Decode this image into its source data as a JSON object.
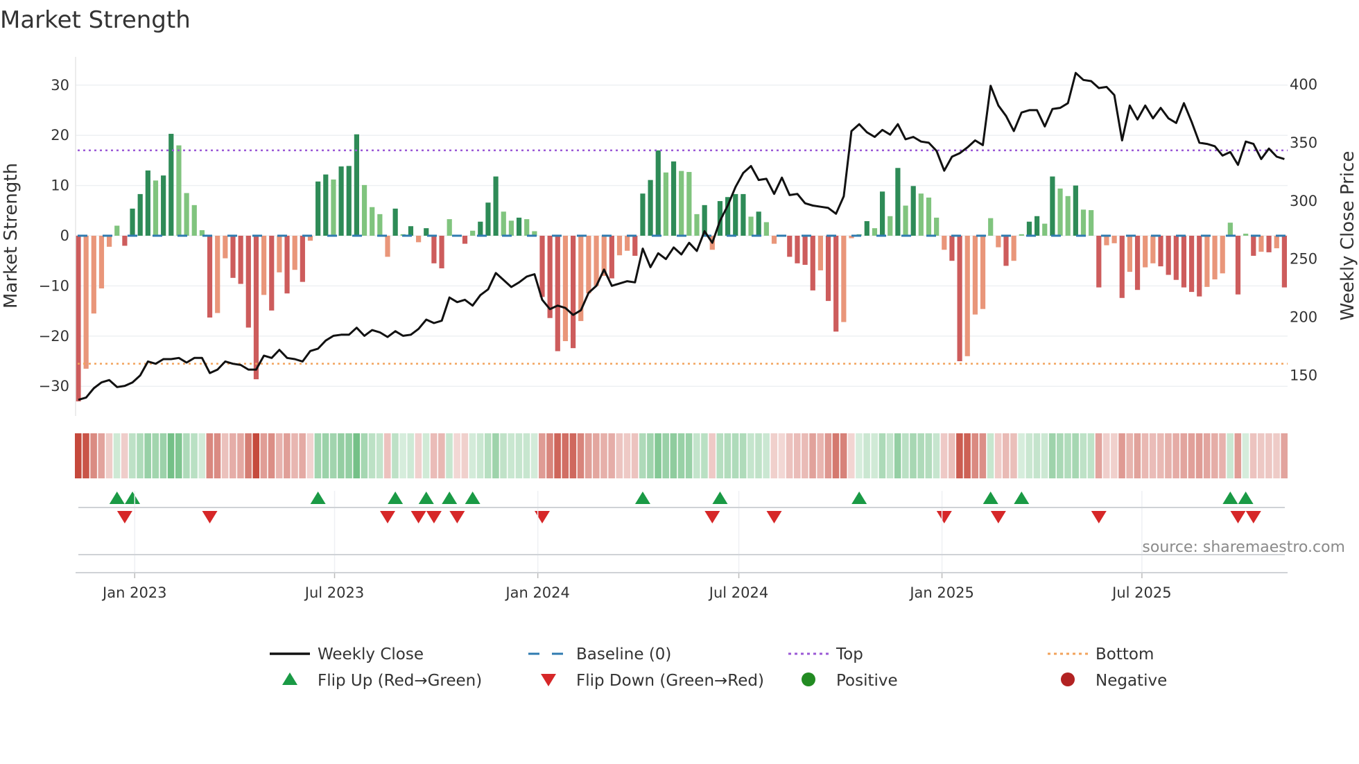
{
  "chart_data": {
    "type": "bar",
    "title": "Market Strength",
    "ylabel": "Market Strength",
    "y2label": "Weekly Close Price",
    "ylim": [
      -35,
      35
    ],
    "y2lim": [
      120,
      410
    ],
    "yticks": [
      30,
      20,
      10,
      0,
      -10,
      -20,
      -30
    ],
    "y2ticks": [
      400,
      350,
      300,
      250,
      200,
      150
    ],
    "ytick_labels": [
      "30",
      "20",
      "10",
      "0",
      "−10",
      "−20",
      "−30"
    ],
    "y2tick_labels": [
      "400",
      "350",
      "300",
      "250",
      "200",
      "150"
    ],
    "top_level": 17,
    "bottom_level": -25.5,
    "baseline": 0,
    "xticks": [
      {
        "label": "Jan 2023",
        "week": 7.29
      },
      {
        "label": "Jul 2023",
        "week": 33.14
      },
      {
        "label": "Jan 2024",
        "week": 59.43
      },
      {
        "label": "Jul 2024",
        "week": 85.43
      },
      {
        "label": "Jan 2025",
        "week": 111.71
      },
      {
        "label": "Jul 2025",
        "week": 137.57
      }
    ],
    "strength": [
      -33,
      -26.5,
      -15.5,
      -10.5,
      -2.2,
      2,
      -2,
      5.4,
      8.3,
      13,
      11,
      12,
      20.3,
      18,
      8.5,
      6.1,
      1.1,
      -16.3,
      -15.4,
      -4.5,
      -8.4,
      -9.6,
      -18.3,
      -28.6,
      -11.8,
      -14.9,
      -7.3,
      -11.5,
      -6.8,
      -9.2,
      -1,
      10.8,
      12.2,
      11.2,
      13.8,
      13.9,
      20.2,
      10.1,
      5.7,
      4.3,
      -4.2,
      5.4,
      0.3,
      1.9,
      -1.3,
      1.5,
      -5.5,
      -6.5,
      3.3,
      -0.2,
      -1.6,
      1,
      2.8,
      6.6,
      11.8,
      4.8,
      3,
      3.6,
      3.3,
      0.9,
      -12.2,
      -16.4,
      -23,
      -21,
      -22.4,
      -17,
      -11.5,
      -10,
      -8,
      -8.5,
      -3.9,
      -3,
      -4,
      8.4,
      11.1,
      17,
      12.6,
      14.8,
      12.9,
      12.7,
      4.3,
      6.1,
      -2.8,
      6.9,
      7.7,
      8.3,
      8.3,
      3.8,
      4.8,
      2.7,
      -1.6,
      -0.2,
      -4.2,
      -5.5,
      -5.8,
      -10.9,
      -6.9,
      -13,
      -19.1,
      -17.2,
      -0.5,
      0.3,
      2.9,
      1.5,
      8.8,
      3.9,
      13.5,
      6,
      9.9,
      8.4,
      7.6,
      3.6,
      -2.8,
      -5,
      -25,
      -24,
      -15.7,
      -14.6,
      3.5,
      -2.3,
      -6,
      -5,
      0.3,
      2.8,
      3.9,
      2.4,
      11.8,
      9.4,
      7.9,
      10,
      5.2,
      5.1,
      -10.3,
      -1.9,
      -1.5,
      -12.4,
      -7.2,
      -10.8,
      -6.3,
      -5.5,
      -6.1,
      -7.8,
      -8.8,
      -10.3,
      -11.2,
      -12.1,
      -10.2,
      -8.7,
      -7.5,
      2.6,
      -11.7,
      0.4,
      -4,
      -3.2,
      -3.3,
      -2.5,
      -10.3
    ],
    "weekly_close": [
      129,
      131,
      139,
      144,
      146,
      140,
      141,
      144,
      150,
      162,
      160,
      164,
      164,
      165,
      161,
      165,
      165,
      152,
      155,
      162,
      160,
      159,
      155,
      155,
      167,
      165,
      172,
      165,
      164,
      162,
      171,
      173,
      180,
      184,
      185,
      185,
      191,
      184,
      189,
      187,
      183,
      188,
      184,
      185,
      190,
      198,
      195,
      197,
      217,
      213,
      215,
      210,
      219,
      224,
      238,
      232,
      226,
      230,
      235,
      237,
      215,
      207,
      210,
      208,
      202,
      206,
      221,
      227,
      241,
      227,
      229,
      231,
      230,
      259,
      243,
      255,
      250,
      260,
      254,
      264,
      257,
      274,
      264,
      283,
      296,
      312,
      324,
      330,
      318,
      319,
      306,
      320,
      305,
      306,
      298,
      296,
      295,
      294,
      289,
      304,
      360,
      366,
      359,
      355,
      361,
      357,
      366,
      353,
      355,
      351,
      350,
      343,
      326,
      338,
      341,
      346,
      352,
      348,
      399,
      382,
      373,
      360,
      376,
      378,
      378,
      364,
      379,
      380,
      384,
      410,
      404,
      403,
      397,
      398,
      391,
      352,
      382,
      370,
      382,
      371,
      380,
      371,
      367,
      384,
      368,
      350,
      349,
      347,
      339,
      342,
      331,
      351,
      349,
      336,
      345,
      338,
      336
    ],
    "legend": {
      "placement": "bottom",
      "items": [
        {
          "label": "Weekly Close",
          "symbol": "line"
        },
        {
          "label": "Baseline (0)",
          "symbol": "dash"
        },
        {
          "label": "Top",
          "symbol": "dot-purple"
        },
        {
          "label": "Bottom",
          "symbol": "dot-orange"
        },
        {
          "label": "Flip Up (Red→Green)",
          "symbol": "triangle-up"
        },
        {
          "label": "Flip Down (Green→Red)",
          "symbol": "triangle-down"
        },
        {
          "label": "Positive",
          "symbol": "circle-green"
        },
        {
          "label": "Negative",
          "symbol": "circle-red"
        }
      ]
    },
    "source": "source: sharemaestro.com",
    "colors": {
      "pos_strong": "#2e8b57",
      "pos_weak": "#80c47e",
      "neg_strong": "#cd5c5c",
      "neg_weak": "#e9967a",
      "line": "#111111",
      "baseline": "#2f7bb0",
      "top": "#9b59d6",
      "bottom": "#f2a35c",
      "flip_up": "#1a9a45",
      "flip_down": "#d62728",
      "positive": "#228b22",
      "negative": "#b22222"
    }
  }
}
